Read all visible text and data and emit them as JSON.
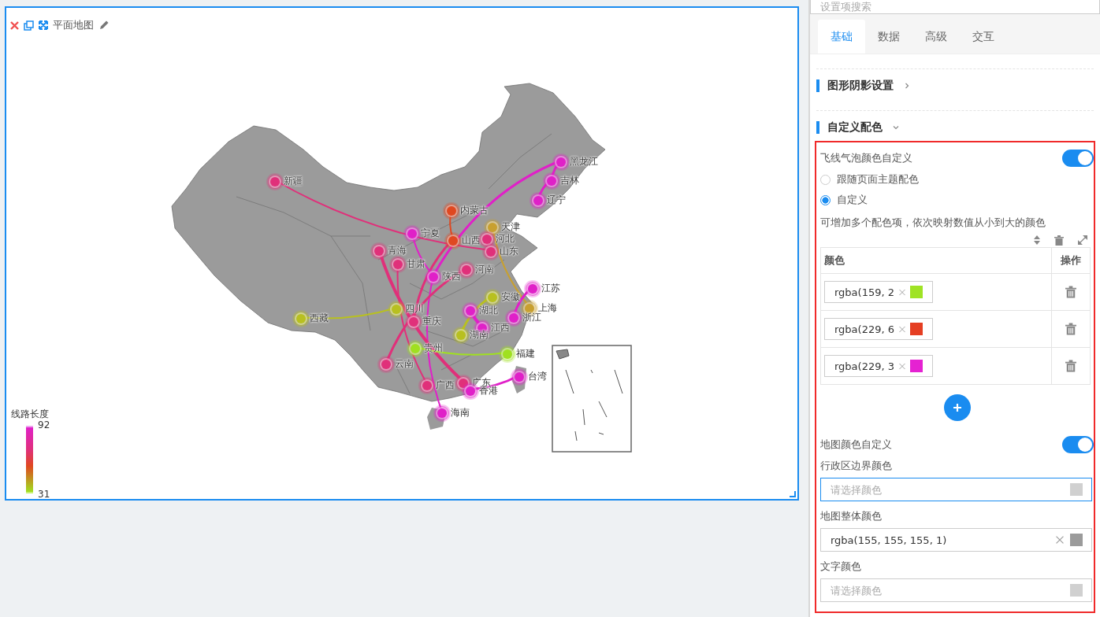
{
  "canvas": {
    "title": "平面地图",
    "provinces": [
      {
        "label": "黑龙江",
        "color": "#e020c8"
      },
      {
        "label": "新疆",
        "color": "#e0307a"
      },
      {
        "label": "吉林",
        "color": "#e020c8"
      },
      {
        "label": "辽宁",
        "color": "#e020c8"
      },
      {
        "label": "内蒙古",
        "color": "#e04820"
      },
      {
        "label": "天津",
        "color": "#c8a030"
      },
      {
        "label": "宁夏",
        "color": "#e020c8"
      },
      {
        "label": "山西",
        "color": "#e04820"
      },
      {
        "label": "河北",
        "color": "#e0307a"
      },
      {
        "label": "青海",
        "color": "#e0307a"
      },
      {
        "label": "甘肃",
        "color": "#e0307a"
      },
      {
        "label": "山东",
        "color": "#e0307a"
      },
      {
        "label": "陕西",
        "color": "#e020c8"
      },
      {
        "label": "河南",
        "color": "#e0307a"
      },
      {
        "label": "江苏",
        "color": "#e020c8"
      },
      {
        "label": "安徽",
        "color": "#b8c020"
      },
      {
        "label": "上海",
        "color": "#c8a030"
      },
      {
        "label": "西藏",
        "color": "#b8c020"
      },
      {
        "label": "四川",
        "color": "#b8c020"
      },
      {
        "label": "重庆",
        "color": "#e0307a"
      },
      {
        "label": "湖北",
        "color": "#e020c8"
      },
      {
        "label": "浙江",
        "color": "#e020c8"
      },
      {
        "label": "江西",
        "color": "#e020c8"
      },
      {
        "label": "湖南",
        "color": "#b8c020"
      },
      {
        "label": "贵州",
        "color": "#a0e020"
      },
      {
        "label": "福建",
        "color": "#a0e020"
      },
      {
        "label": "云南",
        "color": "#e0307a"
      },
      {
        "label": "台湾",
        "color": "#e020c8"
      },
      {
        "label": "广西",
        "color": "#e0307a"
      },
      {
        "label": "广东",
        "color": "#e0307a"
      },
      {
        "label": "香港",
        "color": "#e020c8"
      },
      {
        "label": "海南",
        "color": "#e020c8"
      }
    ],
    "legend": {
      "title": "线路长度",
      "max": "92",
      "min": "31"
    }
  },
  "settings": {
    "search": {
      "placeholder": "设置项搜索"
    },
    "tabs": [
      {
        "label": "基础",
        "selected": true
      },
      {
        "label": "数据",
        "selected": false
      },
      {
        "label": "高级",
        "selected": false
      },
      {
        "label": "交互",
        "selected": false
      }
    ],
    "sections": [
      {
        "title": "图形阴影设置",
        "expanded": false
      },
      {
        "title": "自定义配色",
        "expanded": true
      }
    ],
    "flyline_color": {
      "label": "飞线气泡颜色自定义",
      "on": true,
      "options": [
        {
          "label": "跟随页面主题配色",
          "selected": false
        },
        {
          "label": "自定义",
          "selected": true
        }
      ],
      "hint": "可增加多个配色项，依次映射数值从小到大的颜色",
      "columns": [
        "颜色",
        "操作"
      ],
      "rows": [
        {
          "value": "rgba(159, 2",
          "color": "#9fe324"
        },
        {
          "value": "rgba(229, 6",
          "color": "#e53e22"
        },
        {
          "value": "rgba(229, 3",
          "color": "#e522d2"
        }
      ]
    },
    "map_color": {
      "label": "地图颜色自定义",
      "on": true,
      "fields": [
        {
          "label": "行政区边界颜色",
          "placeholder": "请选择颜色",
          "focused": true
        },
        {
          "label": "地图整体颜色",
          "value": "rgba(155, 155, 155, 1)",
          "color": "#9b9b9b",
          "focused": false
        },
        {
          "label": "文字颜色",
          "placeholder": "请选择颜色",
          "focused": false
        }
      ]
    }
  }
}
